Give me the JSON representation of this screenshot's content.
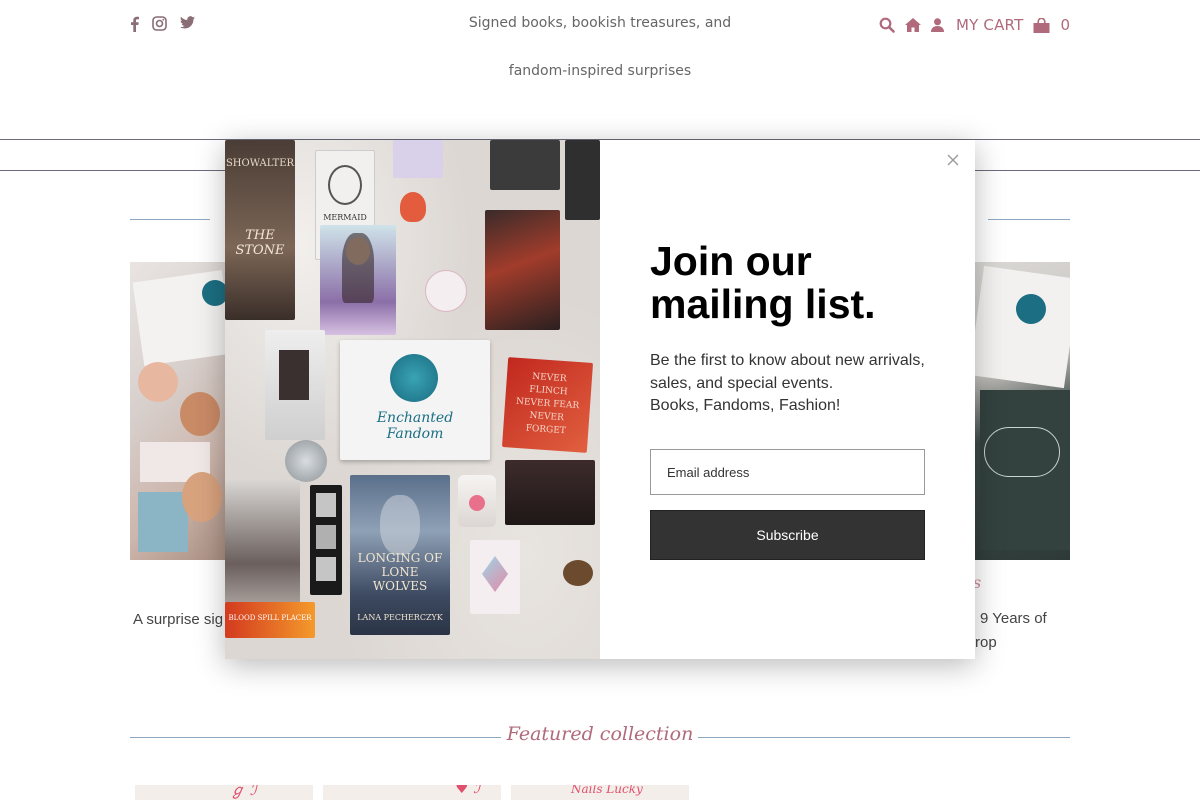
{
  "header": {
    "social_icons": [
      "facebook-icon",
      "instagram-icon",
      "twitter-icon"
    ],
    "tagline_line1": "Signed books, bookish treasures, and",
    "tagline_line2": "fandom-inspired surprises",
    "cart_label": "MY CART",
    "cart_count": "0",
    "accent_color": "#b06a7b"
  },
  "background": {
    "left_text": "A surprise sig",
    "right_text_line1": "9 Years of",
    "right_text_line2": "rop",
    "right_title_fragment": "s",
    "featured_title": "Featured collection",
    "thumb3_text": "Nails Lucky"
  },
  "modal": {
    "image_alt": "Enchanted Fandom",
    "collage": {
      "box_brand": "Enchanted Fandom",
      "book1_title": "LONGING OF LONE WOLVES",
      "book1_author": "LANA PECHERCZYK",
      "book2_title": "THE STONE",
      "book2_author": "SHOWALTER",
      "tag_text": "MERMAID",
      "cards_text": "NEVER FLINCH NEVER FEAR NEVER FORGET",
      "bookmark_text": "BLOOD SPILL PLACER"
    },
    "heading": "Join our mailing list.",
    "description_line1": "Be the first to know about new arrivals, sales, and special events.",
    "description_line2": "Books, Fandoms, Fashion!",
    "email_placeholder": "Email address",
    "subscribe_label": "Subscribe"
  }
}
